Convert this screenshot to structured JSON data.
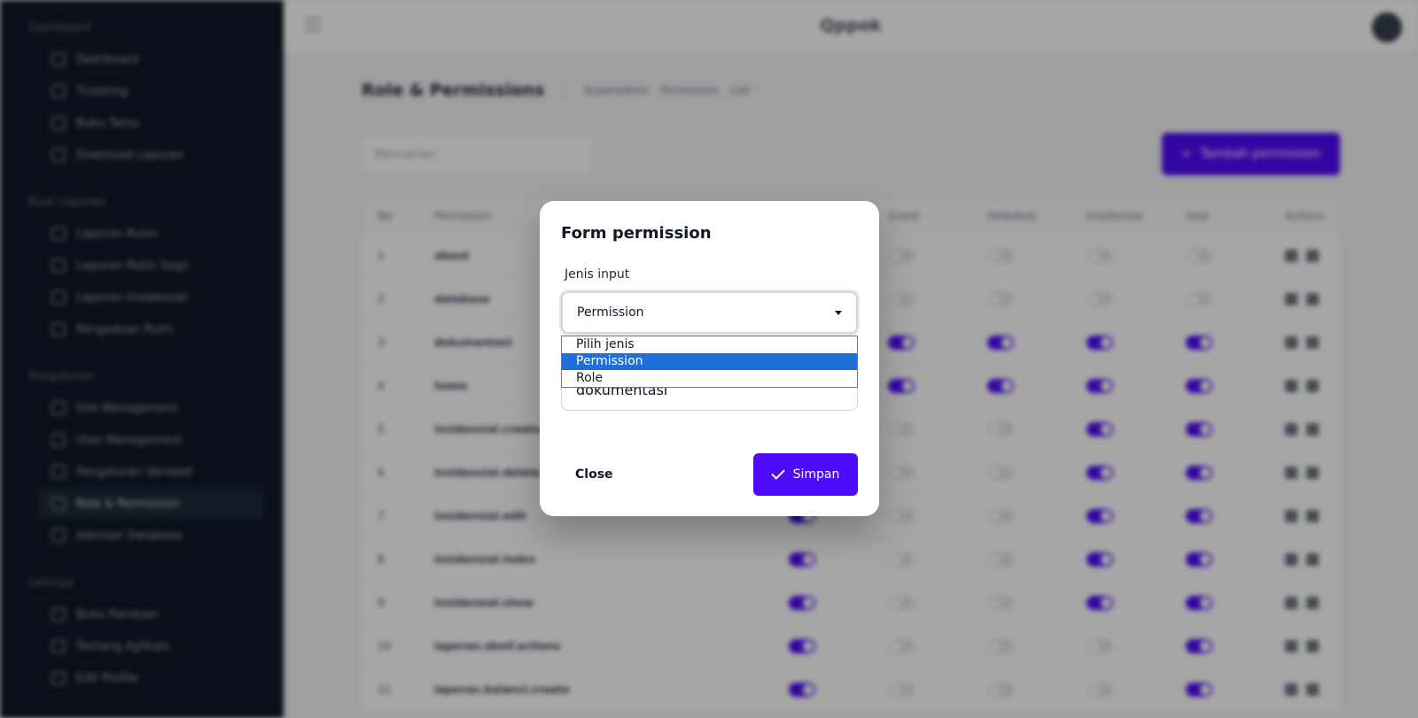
{
  "app": {
    "brand": "Qppok"
  },
  "sidebar": {
    "sections": [
      {
        "heading": "Dashboard",
        "items": [
          "Dashboard",
          "Ticketing",
          "Buku Tamu",
          "Download Laporan"
        ]
      },
      {
        "heading": "Buat Laporan",
        "items": [
          "Laporan Rutin",
          "Laporan Rutin Segs",
          "Laporan Insidensial",
          "Pengaduan Rutin"
        ]
      },
      {
        "heading": "Pengaturan",
        "items": [
          "Site Management",
          "User Management",
          "Pengaturan Variabel",
          "Role & Permission",
          "Admiser Database"
        ]
      },
      {
        "heading": "Lainnya",
        "items": [
          "Buku Panduan",
          "Tentang Aplikasi",
          "Edit Profile"
        ]
      }
    ],
    "active_item": "Role & Permission"
  },
  "page": {
    "title": "Role & Permissions",
    "breadcrumb": [
      "Superadmin",
      "Permission",
      "List"
    ],
    "search_placeholder": "Pencarian",
    "add_button": "Tambah permission"
  },
  "table": {
    "headers": [
      "No",
      "Permission",
      "",
      "Guest",
      "Helpdesk",
      "Insidensial",
      "User",
      "Actions"
    ],
    "rows": [
      {
        "no": "1",
        "name": "about",
        "toggles": [
          false,
          false,
          false,
          false,
          false
        ]
      },
      {
        "no": "2",
        "name": "database",
        "toggles": [
          false,
          false,
          false,
          false,
          false
        ]
      },
      {
        "no": "3",
        "name": "dokumentasi",
        "toggles": [
          true,
          true,
          true,
          true,
          true
        ]
      },
      {
        "no": "4",
        "name": "home",
        "toggles": [
          true,
          true,
          true,
          true,
          true
        ]
      },
      {
        "no": "5",
        "name": "insidensial.create",
        "toggles": [
          true,
          false,
          false,
          true,
          true
        ]
      },
      {
        "no": "6",
        "name": "insidensial.delete",
        "toggles": [
          true,
          false,
          false,
          true,
          true
        ]
      },
      {
        "no": "7",
        "name": "insidensial.edit",
        "toggles": [
          true,
          false,
          false,
          true,
          true
        ]
      },
      {
        "no": "8",
        "name": "insidensial.index",
        "toggles": [
          true,
          false,
          false,
          true,
          true
        ]
      },
      {
        "no": "9",
        "name": "insidensial.show",
        "toggles": [
          true,
          false,
          false,
          true,
          true
        ]
      },
      {
        "no": "10",
        "name": "laporan.sbmf.actions",
        "toggles": [
          true,
          false,
          false,
          false,
          true
        ]
      },
      {
        "no": "11",
        "name": "laporan.balancl.create",
        "toggles": [
          true,
          false,
          false,
          false,
          true
        ]
      }
    ]
  },
  "modal": {
    "title": "Form permission",
    "jenis_label": "Jenis input",
    "jenis_value": "Permission",
    "options": [
      "Pilih jenis",
      "Permission",
      "Role"
    ],
    "selected_option": 1,
    "name_value": "dokumentasi",
    "close_label": "Close",
    "save_label": "Simpan"
  },
  "colors": {
    "accent": "#4f0afa",
    "sidebar": "#111827",
    "option_highlight": "#1e6fd9"
  }
}
